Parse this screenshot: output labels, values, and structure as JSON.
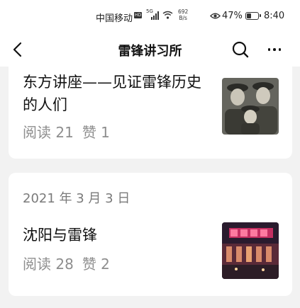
{
  "status_bar": {
    "carrier": "中国移动",
    "hd_badge": "HD",
    "network_type": "5G",
    "net_speed_value": "692",
    "net_speed_unit": "B/s",
    "battery_percent": "47%",
    "battery_level": 0.47,
    "time": "8:40",
    "icons": [
      "signal-icon",
      "wifi-icon",
      "eye-icon",
      "battery-icon"
    ]
  },
  "nav": {
    "title": "雷锋讲习所",
    "icons": [
      "back-arrow-icon",
      "search-icon",
      "more-icon"
    ]
  },
  "articles": [
    {
      "title": "东方讲座——见证雷锋历史的人们",
      "reads": "阅读 21",
      "likes": "赞 1",
      "thumbnail": "vintage-photo-soldiers"
    },
    {
      "date": "2021 年 3 月 3 日",
      "title": "沈阳与雷锋",
      "reads": "阅读 28",
      "likes": "赞 2",
      "thumbnail": "night-station-building"
    }
  ],
  "colors": {
    "page_background": "#f2f2f2",
    "card_background": "#ffffff",
    "meta_text": "#8e8e8e"
  }
}
